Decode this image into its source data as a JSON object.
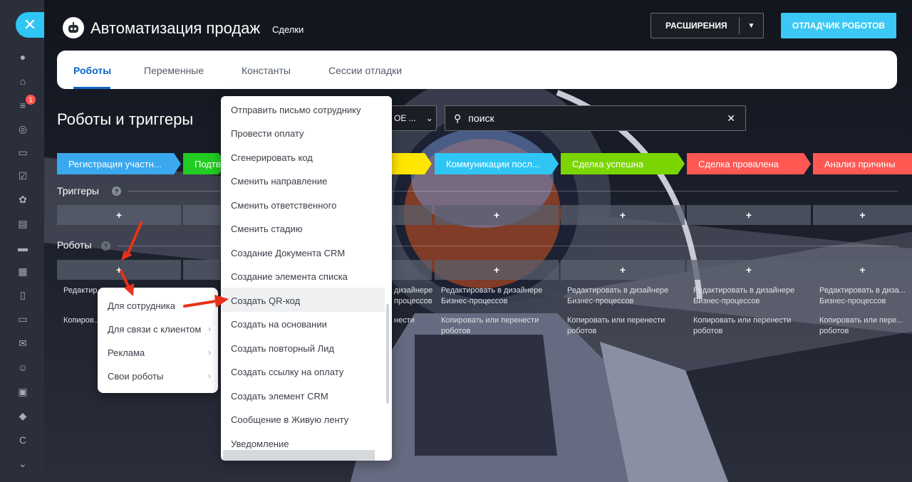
{
  "header": {
    "app_title": "Автоматизация продаж",
    "subtitle": "Сделки",
    "extensions_label": "РАСШИРЕНИЯ",
    "debugger_label": "ОТЛАДЧИК РОБОТОВ"
  },
  "tabs": [
    {
      "label": "Роботы",
      "active": true
    },
    {
      "label": "Переменные"
    },
    {
      "label": "Константы"
    },
    {
      "label": "Сессии отладки"
    }
  ],
  "section_title": "Роботы и триггеры",
  "stage_filter_value": "ОЕ ...",
  "search": {
    "value": "поиск"
  },
  "stages": [
    {
      "label": "Регистрация участн...",
      "color": "#39a8ef"
    },
    {
      "label": "Подтв",
      "color": "#22cc22"
    },
    {
      "label": "Коммуникации посл...",
      "color": "#2fc6f6"
    },
    {
      "label": "Сделка успешна",
      "color": "#7bd500"
    },
    {
      "label": "Сделка провалена",
      "color": "#ff5752"
    },
    {
      "label": "Анализ причины",
      "color": "#ff5752"
    }
  ],
  "triggers_label": "Триггеры",
  "robots_label": "Роботы",
  "help_mark": "?",
  "plus": "+",
  "cell_texts": {
    "edit": "Редактировать в дизайнере Бизнес-процессов",
    "edit_cut": "Редактировать в диза... Бизнес-процессов",
    "edit_short": "Редактир... Бизнес-...",
    "edit_right": "дизайнере процессов",
    "copy": "Копировать или перенести роботов",
    "copy_cut": "Копировать или пере... роботов",
    "copy_short": "Копиров... роботов",
    "copy_right": "нести"
  },
  "menu_left": [
    {
      "label": "Для сотрудника",
      "has_sub": false
    },
    {
      "label": "Для связи с клиентом",
      "has_sub": true
    },
    {
      "label": "Реклама",
      "has_sub": true
    },
    {
      "label": "Свои роботы",
      "has_sub": true
    }
  ],
  "menu_right": [
    "Отправить письмо сотруднику",
    "Провести оплату",
    "Сгенерировать код",
    "Сменить направление",
    "Сменить ответственного",
    "Сменить стадию",
    "Создание Документа CRM",
    "Создание элемента списка",
    "Создать QR-код",
    "Создать на основании",
    "Создать повторный Лид",
    "Создать ссылку на оплату",
    "Создать элемент CRM",
    "Сообщение в Живую ленту",
    "Уведомление"
  ],
  "rail": {
    "badge": "1",
    "letter": "C"
  },
  "colors": {
    "accent": "#3bc8f5",
    "tab_active": "#0b66c3",
    "arrow": "#e8311a"
  }
}
